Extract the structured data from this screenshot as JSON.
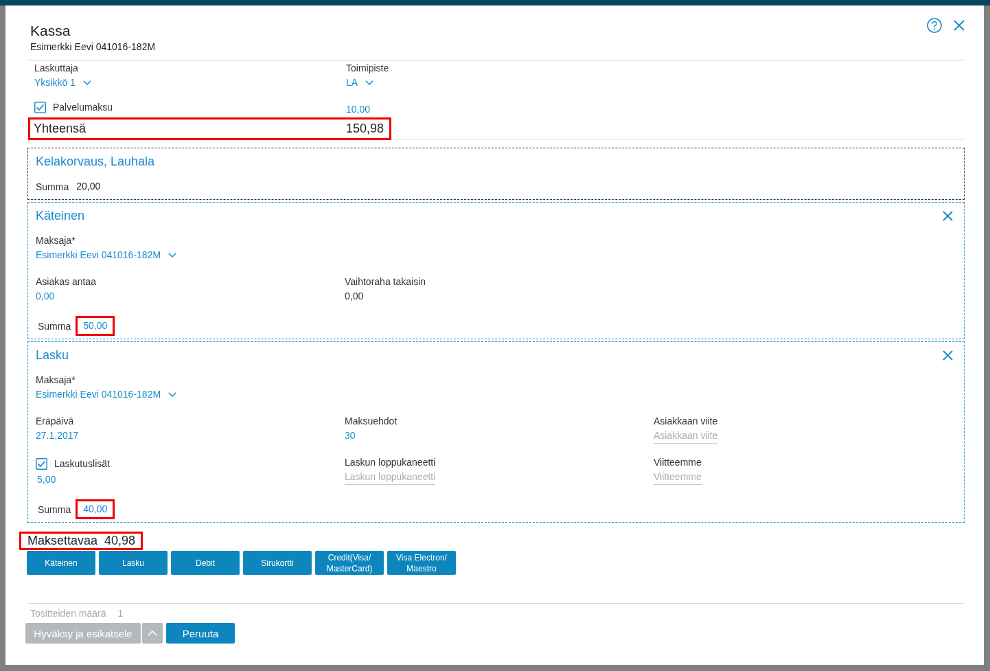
{
  "dialog": {
    "title": "Kassa",
    "subtitle": "Esimerkki Eevi 041016-182M"
  },
  "billing": [
    {
      "label": "Laskuttaja",
      "value": "Yksikkö 1"
    },
    {
      "label": "Toimipiste",
      "value": "LA"
    }
  ],
  "service_fee": {
    "label": "Palvelumaksu",
    "checked": true,
    "amount": "10,00"
  },
  "total": {
    "label": "Yhteensä",
    "value": "150,98",
    "highlighted": true
  },
  "payments": [
    {
      "kind": "reimbursement",
      "title": "Kelakorvaus, Lauhala",
      "removable": false,
      "sum_label": "Summa",
      "sum": "20,00",
      "sum_editable": false,
      "highlighted": false
    },
    {
      "kind": "cash",
      "title": "Käteinen",
      "removable": true,
      "payer": {
        "label": "Maksaja*",
        "value": "Esimerkki Eevi 041016-182M"
      },
      "fields": [
        {
          "kind": "editable",
          "label": "Asiakas antaa",
          "value": "0,00"
        },
        {
          "kind": "readonly",
          "label": "Vaihtoraha takaisin",
          "value": "0,00"
        }
      ],
      "sum_label": "Summa",
      "sum": "50,00",
      "sum_editable": true,
      "highlighted": true
    },
    {
      "kind": "invoice",
      "title": "Lasku",
      "removable": true,
      "payer": {
        "label": "Maksaja*",
        "value": "Esimerkki Eevi 041016-182M"
      },
      "fields": [
        {
          "kind": "editable",
          "label": "Eräpäivä",
          "value": "27.1.2017"
        },
        {
          "kind": "editable",
          "label": "Maksuehdot",
          "value": "30"
        },
        {
          "kind": "input",
          "label": "Asiakkaan viite",
          "placeholder": "Asiakkaan viite"
        },
        {
          "kind": "checkbox",
          "label": "Laskutuslisät",
          "checked": true,
          "value": "5,00"
        },
        {
          "kind": "input",
          "label": "Laskun loppukaneetti",
          "placeholder": "Laskun loppukaneetti"
        },
        {
          "kind": "input",
          "label": "Viitteemme",
          "placeholder": "Viitteemme"
        }
      ],
      "sum_label": "Summa",
      "sum": "40,00",
      "sum_editable": true,
      "highlighted": true
    }
  ],
  "amount_due": {
    "label": "Maksettavaa",
    "value": "40,98",
    "highlighted": true
  },
  "payment_methods": [
    "Käteinen",
    "Lasku",
    "Debit",
    "Sirukortti",
    "Credit(Visa/ MasterCard)",
    "Visa Electron/ Maestro"
  ],
  "voucher_count": {
    "label": "Tositteiden määrä",
    "value": "1"
  },
  "actions": [
    {
      "label": "Hyväksy ja esikatsele",
      "kind": "split",
      "disabled": true
    },
    {
      "label": "Peruuta",
      "kind": "button",
      "disabled": false
    }
  ]
}
